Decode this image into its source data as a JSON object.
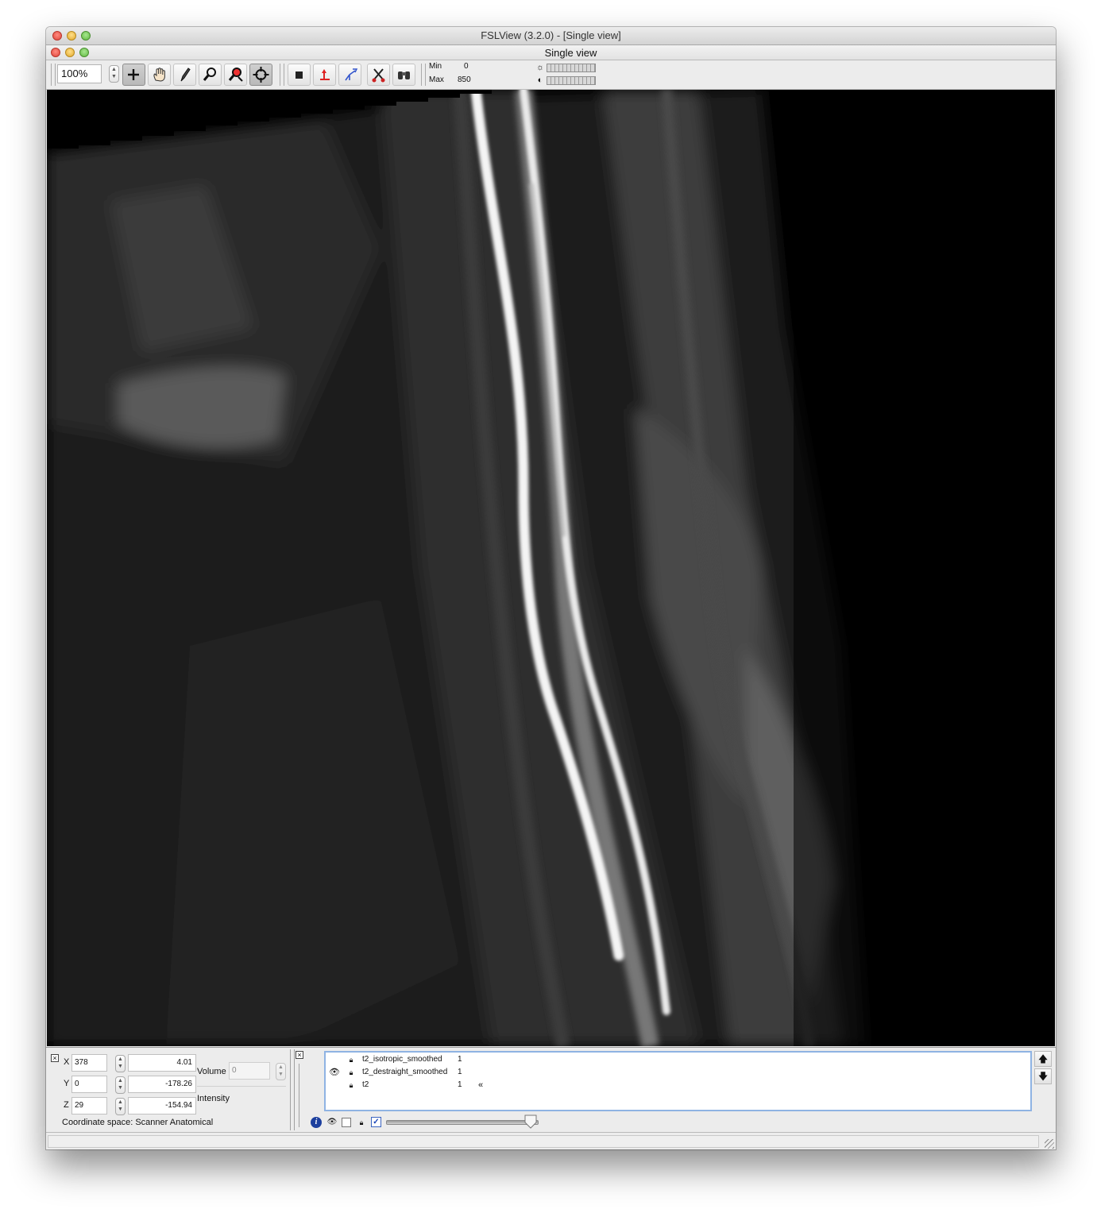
{
  "window": {
    "title": "FSLView (3.2.0) - [Single view]"
  },
  "subwindow": {
    "title": "Single view"
  },
  "toolbar": {
    "zoom": "100%",
    "tools": [
      "cursor-icon",
      "pan-hand-icon",
      "pencil-icon",
      "zoom-magnifier-icon",
      "zoom-region-icon",
      "crosshair-target-icon",
      "fill-box-icon",
      "reset-axis-icon",
      "axis-swap-icon",
      "cut-tool-icon",
      "binoculars-icon"
    ],
    "active_tools": [
      "cursor-icon",
      "crosshair-target-icon"
    ],
    "min_label": "Min",
    "min_value": "0",
    "max_label": "Max",
    "max_value": "850",
    "brightness_icon": "sun-icon",
    "contrast_icon": "contrast-icon"
  },
  "coordinates": {
    "x_label": "X",
    "x_voxel": "378",
    "x_mm": "4.01",
    "y_label": "Y",
    "y_voxel": "0",
    "y_mm": "-178.26",
    "z_label": "Z",
    "z_voxel": "29",
    "z_mm": "-154.94",
    "volume_label": "Volume",
    "volume_value": "0",
    "intensity_label": "Intensity",
    "coordinate_space": "Coordinate space: Scanner Anatomical"
  },
  "layers": [
    {
      "name": "t2_isotropic_smoothed",
      "opacity": "1",
      "visible": false,
      "marker": ""
    },
    {
      "name": "t2_destraight_smoothed",
      "opacity": "1",
      "visible": true,
      "marker": ""
    },
    {
      "name": "t2",
      "opacity": "1",
      "visible": false,
      "marker": "«"
    }
  ],
  "layer_controls": {
    "opacity_slider_fraction": 0.95
  },
  "colors": {
    "selection_border": "#8fb3e3",
    "info_icon": "#1c3f9e"
  }
}
